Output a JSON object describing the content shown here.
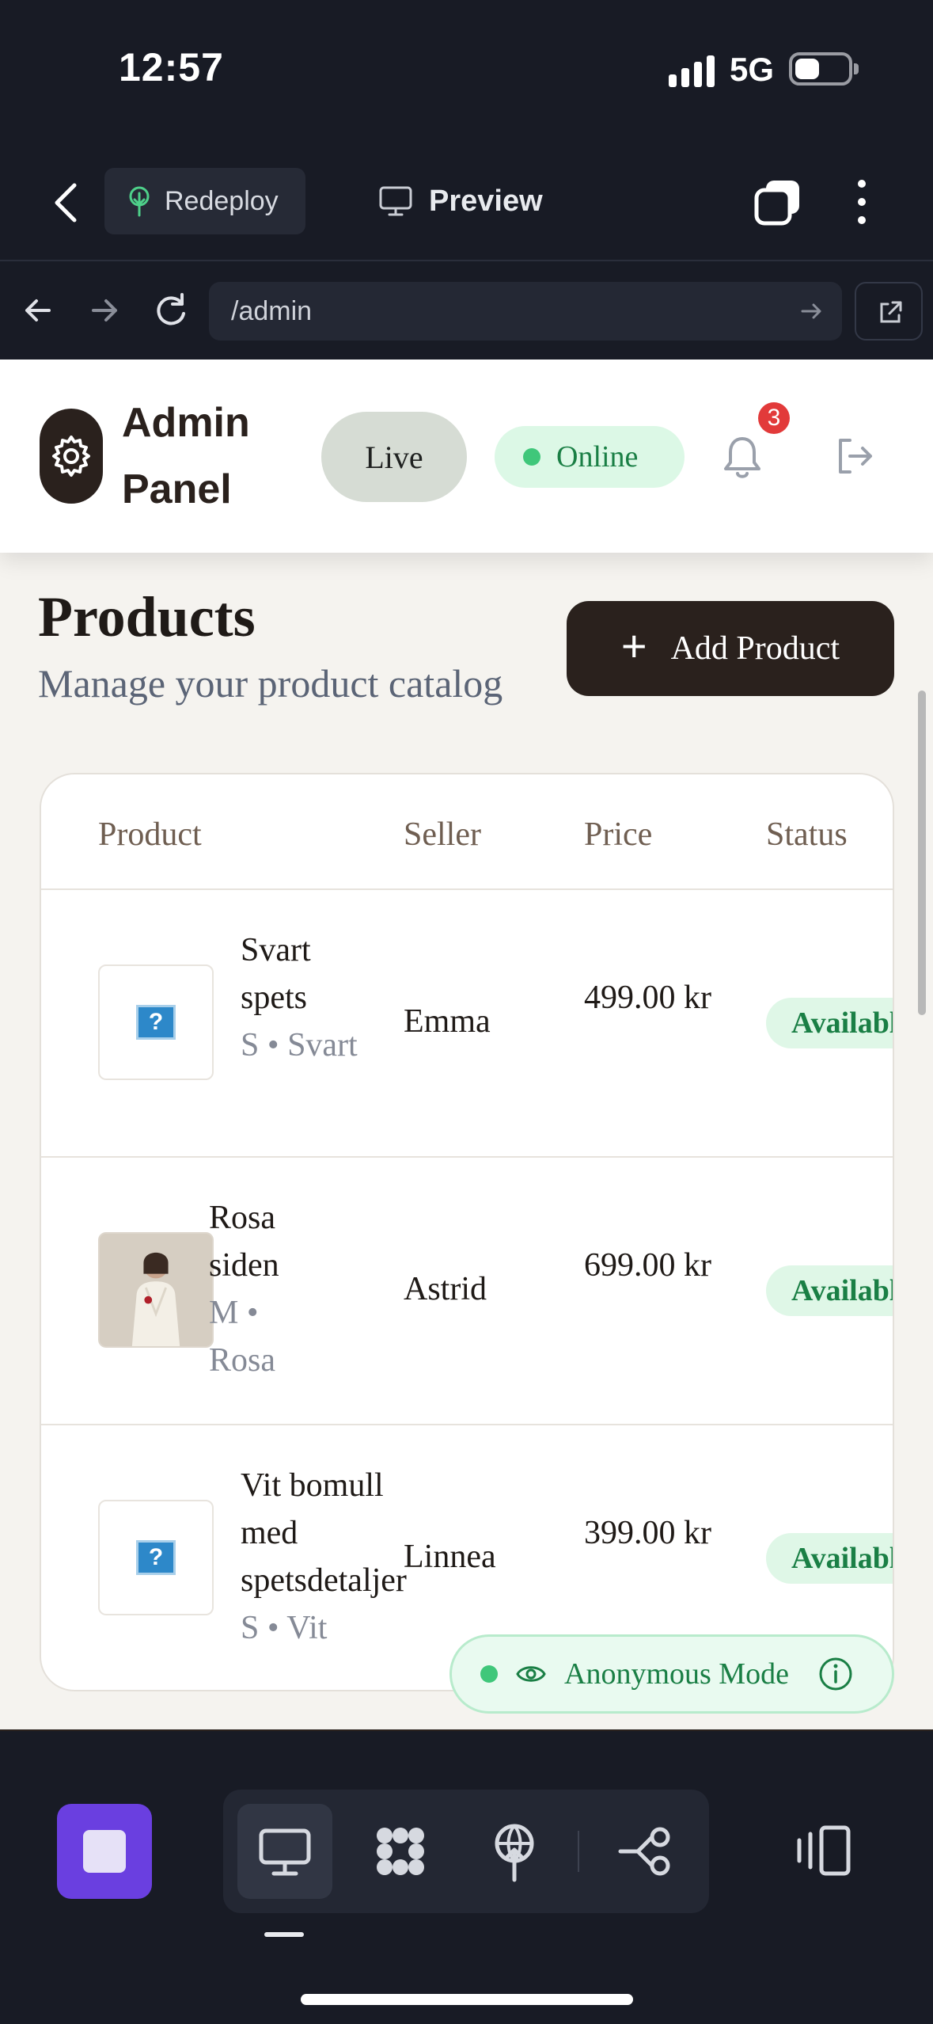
{
  "status_bar": {
    "time": "12:57",
    "network": "5G"
  },
  "editor": {
    "redeploy_label": "Redeploy",
    "preview_label": "Preview"
  },
  "browser": {
    "url": "/admin"
  },
  "header": {
    "brand": "Admin Panel",
    "live_label": "Live",
    "online_label": "Online",
    "notification_count": "3"
  },
  "page": {
    "title": "Products",
    "subtitle": "Manage your product catalog",
    "add_button_label": "Add Product"
  },
  "table": {
    "columns": [
      "Product",
      "Seller",
      "Price",
      "Status"
    ],
    "rows": [
      {
        "name": "Svart spets",
        "meta": "S • Svart",
        "seller": "Emma",
        "price": "499.00 kr",
        "status": "Available",
        "image": "placeholder"
      },
      {
        "name": "Rosa siden",
        "meta": "M • Rosa",
        "seller": "Astrid",
        "price": "699.00 kr",
        "status": "Available",
        "image": "photo"
      },
      {
        "name": "Vit bomull med spetsdetaljer",
        "meta": "S • Vit",
        "seller": "Linnea",
        "price": "399.00 kr",
        "status": "Available",
        "image": "placeholder"
      }
    ]
  },
  "anonymous_label": "Anonymous Mode",
  "colors": {
    "editor_bg": "#181b25",
    "brand_dark": "#2a211d",
    "success_green": "#1a7f45",
    "accent_purple": "#6a3fe0",
    "badge_red": "#e23a3a"
  },
  "icons": [
    "back-chevron-icon",
    "tree-icon",
    "monitor-icon",
    "tabs-icon",
    "kebab-icon",
    "arrow-left-icon",
    "arrow-right-icon",
    "reload-icon",
    "external-link-icon",
    "gear-icon",
    "bell-icon",
    "logout-icon",
    "plus-icon",
    "eye-icon",
    "info-icon",
    "stop-icon",
    "grid-icon",
    "deploy-icon",
    "flow-icon",
    "panel-icon"
  ]
}
